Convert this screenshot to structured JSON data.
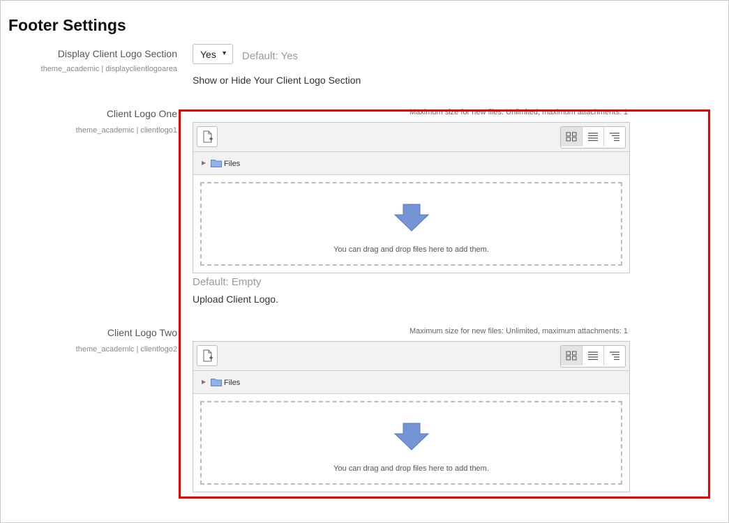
{
  "page": {
    "title": "Footer Settings"
  },
  "display_logo": {
    "label": "Display Client Logo Section",
    "key": "theme_academic | displayclientlogoarea",
    "selected": "Yes",
    "default": "Default: Yes",
    "description": "Show or Hide Your Client Logo Section"
  },
  "logo_one": {
    "label": "Client Logo One",
    "key": "theme_academic | clientlogo1",
    "max_size": "Maximum size for new files: Unlimited, maximum attachments: 1",
    "path": "Files",
    "drop_text": "You can drag and drop files here to add them.",
    "default": "Default: Empty",
    "description": "Upload Client Logo."
  },
  "logo_two": {
    "label": "Client Logo Two",
    "key": "theme_academic | clientlogo2",
    "max_size": "Maximum size for new files: Unlimited, maximum attachments: 1",
    "path": "Files",
    "drop_text": "You can drag and drop files here to add them."
  },
  "icons": {
    "add_file": "add-file-icon",
    "view_icons": "grid-view-icon",
    "view_list": "list-view-icon",
    "view_tree": "tree-view-icon",
    "folder": "folder-icon",
    "drop_arrow": "arrow-down-icon"
  },
  "colors": {
    "highlight": "#ee0000",
    "arrow": "#6b8fd6"
  }
}
